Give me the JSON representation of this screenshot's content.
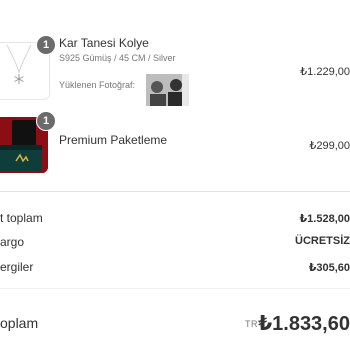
{
  "items": [
    {
      "quantity": "1",
      "title": "Kar Tanesi Kolye",
      "variant": "S925 Gümüş / 45 CM / Silver",
      "upload_label": "Yüklenen Fotoğraf:",
      "price": "₺1.229,00",
      "thumbnail_icon": "snowflake-necklace-icon"
    },
    {
      "quantity": "1",
      "title": "Premium Paketleme",
      "price": "₺299,00",
      "thumbnail_icon": "gift-box-icon"
    }
  ],
  "summary": {
    "subtotal_label": "t toplam",
    "subtotal_value": "₺1.528,00",
    "shipping_label": "argo",
    "shipping_value": "ÜCRETSİZ",
    "taxes_label": "ergiler",
    "taxes_value": "₺305,60"
  },
  "total": {
    "label": "oplam",
    "currency": "TRY",
    "value": "₺1.833,60"
  }
}
